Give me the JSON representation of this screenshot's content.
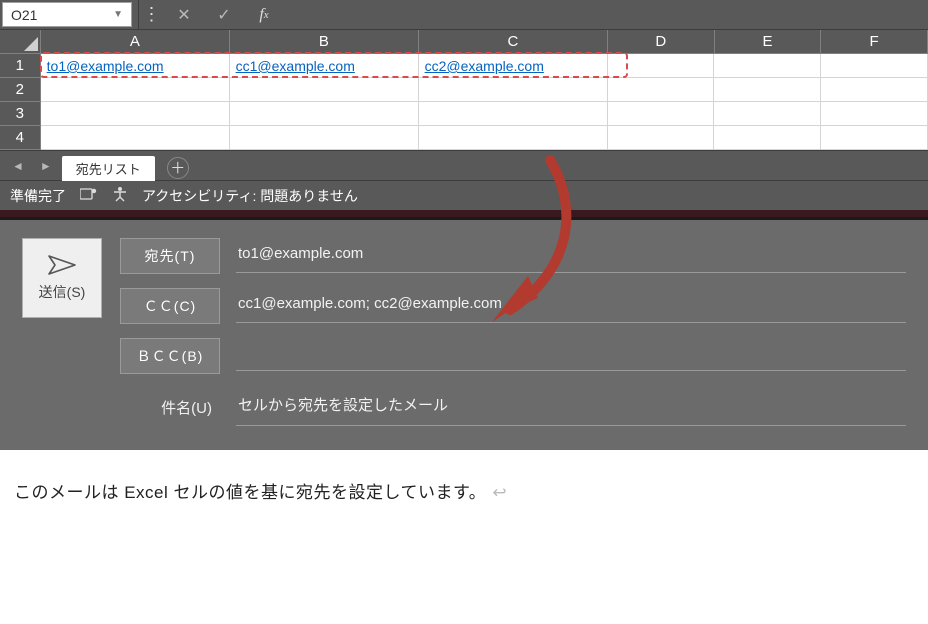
{
  "excel": {
    "namebox": "O21",
    "columns": [
      "A",
      "B",
      "C",
      "D",
      "E",
      "F"
    ],
    "rows": [
      "1",
      "2",
      "3",
      "4"
    ],
    "cells": {
      "r1": [
        "to1@example.com",
        "cc1@example.com",
        "cc2@example.com",
        "",
        "",
        ""
      ]
    },
    "sheet_tab": "宛先リスト",
    "status_ready": "準備完了",
    "accessibility_label": "アクセシビリティ: 問題ありません"
  },
  "compose": {
    "send_label": "送信(S)",
    "to_btn": "宛先(T)",
    "cc_btn": "ＣＣ(C)",
    "bcc_btn": "ＢＣＣ(B)",
    "subject_label": "件名(U)",
    "to_value": "to1@example.com",
    "cc_value": "cc1@example.com; cc2@example.com",
    "bcc_value": "",
    "subject_value": "セルから宛先を設定したメール"
  },
  "body_text": "このメールは Excel セルの値を基に宛先を設定しています。"
}
